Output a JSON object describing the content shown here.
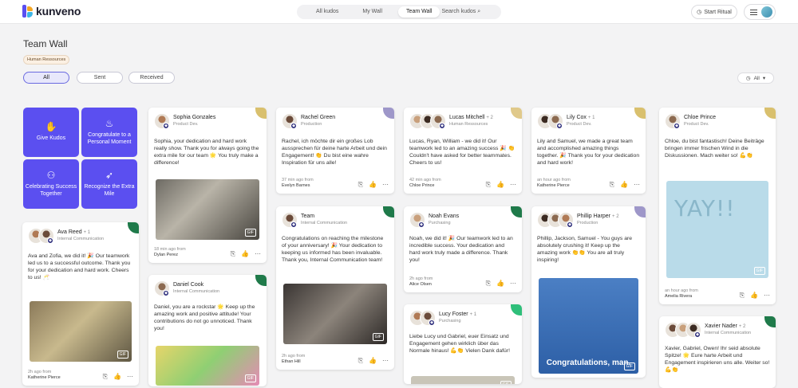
{
  "app": {
    "name": "kunveno"
  },
  "nav": {
    "tabs": [
      "All kudos",
      "My Wall",
      "Team Wall",
      "Search kudos"
    ],
    "active": "Team Wall"
  },
  "header": {
    "ritual": "Start Ritual"
  },
  "page": {
    "title": "Team Wall",
    "department": "Human Ressources"
  },
  "filters": {
    "options": [
      "All",
      "Sent",
      "Received"
    ],
    "active": "All",
    "scope": "All"
  },
  "tiles": [
    "Give Kudos",
    "Congratulate to a Personal Moment",
    "Celebrating Success Together",
    "Recognize the Extra Mile"
  ],
  "cards": [
    {
      "name": "Sophia Gonzales",
      "plus": "",
      "dept": "Product Dev.",
      "message": "Sophia, your dedication and hard work really show. Thank you for always going the extra mile for our team 🌟 You truly make a difference!",
      "time": "18 min ago from",
      "from": "Dylan Perez",
      "corner": "#d9c06e",
      "gif": true
    },
    {
      "name": "Rachel Green",
      "plus": "",
      "dept": "Production",
      "message": "Rachel, ich möchte dir ein großes Lob aussprechen für deine harte Arbeit und dein Engagement! 👏 Du bist eine wahre Inspiration für uns alle!",
      "time": "37 min ago from",
      "from": "Evelyn Barnes",
      "corner": "#9e97c9",
      "gif": false
    },
    {
      "name": "Lucas Mitchell",
      "plus": "+ 2",
      "dept": "Human Ressources",
      "message": "Lucas, Ryan, William - we did it! Our teamwork led to an amazing success 🎉 👏 Couldn't have asked for better teammates. Cheers to us!",
      "time": "42 min ago from",
      "from": "Chloe Prince",
      "corner": "#e0c98a",
      "gif": false
    },
    {
      "name": "Lily Cox",
      "plus": "+ 1",
      "dept": "Product Dev.",
      "message": "Lily and Samuel, we made a great team and accomplished amazing things together. 🎉 Thank you for your dedication and hard work!",
      "time": "an hour ago from",
      "from": "Katherine Pierce",
      "corner": "#d9c06e",
      "gif": false
    },
    {
      "name": "Chloe Prince",
      "plus": "",
      "dept": "Product Dev.",
      "message": "Chloe, du bist fantastisch! Deine Beiträge bringen immer frischen Wind in die Diskussionen. Mach weiter so! 💪👏",
      "time": "an hour ago from",
      "from": "Amelia Rivera",
      "corner": "#d9c06e",
      "gif": true,
      "gif_text": "YAY!!"
    },
    {
      "name": "Ava Reed",
      "plus": "+ 1",
      "dept": "Internal Communication",
      "message": "Ava and Zofia, we did it! 🎉 Our teamwork led us to a successful outcome. Thank you for your dedication and hard work. Cheers to us! 🥂",
      "time": "2h ago from",
      "from": "Katherine Pierce",
      "corner": "#1f7a4a",
      "gif": true
    },
    {
      "name": "Team",
      "plus": "",
      "dept": "Internal Communication",
      "message": "Congratulations on reaching the milestone of your anniversary! 🎉 Your dedication to keeping us informed has been invaluable. Thank you, Internal Communication team!",
      "time": "2h ago from",
      "from": "Ethan Hill",
      "corner": "#1f7a4a",
      "gif": true
    },
    {
      "name": "Noah Evans",
      "plus": "",
      "dept": "Purchasing",
      "message": "Noah, we did it! 🎉 Our teamwork led to an incredible success. Your dedication and hard work truly made a difference. Thank you!",
      "time": "2h ago from",
      "from": "Alice Olsen",
      "corner": "#1f7a4a",
      "gif": false
    },
    {
      "name": "Phillip Harper",
      "plus": "+ 2",
      "dept": "Production",
      "message": "Phillip, Jackson, Samuel - You guys are absolutely crushing it! Keep up the amazing work 👏👏 You are all truly inspiring!",
      "time": "",
      "from": "",
      "corner": "#9e97c9",
      "gif": true,
      "gif_text": "Congratulations, man."
    },
    {
      "name": "Daniel Cook",
      "plus": "",
      "dept": "Internal Communication",
      "message": "Daniel, you are a rockstar 🌟 Keep up the amazing work and positive attitude! Your contributions do not go unnoticed. Thank you!",
      "time": "",
      "from": "",
      "corner": "#1f7a4a",
      "gif": true
    },
    {
      "name": "Lucy Foster",
      "plus": "+ 1",
      "dept": "Purchasing",
      "message": "Liebe Lucy und Gabriel, euer Einsatz und Engagement gehen wirklich über das Normale hinaus! 💪👏 Vielen Dank dafür!",
      "time": "",
      "from": "",
      "corner": "#2fbf7a",
      "gif": true
    },
    {
      "name": "Xavier Nader",
      "plus": "+ 2",
      "dept": "Internal Communication",
      "message": "Xavier, Gabriel, Owen! Ihr seid absolute Spitze! 🌟 Eure harte Arbeit und Engagement inspirieren uns alle. Weiter so! 💪👏",
      "time": "",
      "from": "",
      "corner": "#1f7a4a",
      "gif": false
    }
  ],
  "colors": {
    "tile": "#5b4ff0",
    "accent": "#6a6ae0"
  }
}
